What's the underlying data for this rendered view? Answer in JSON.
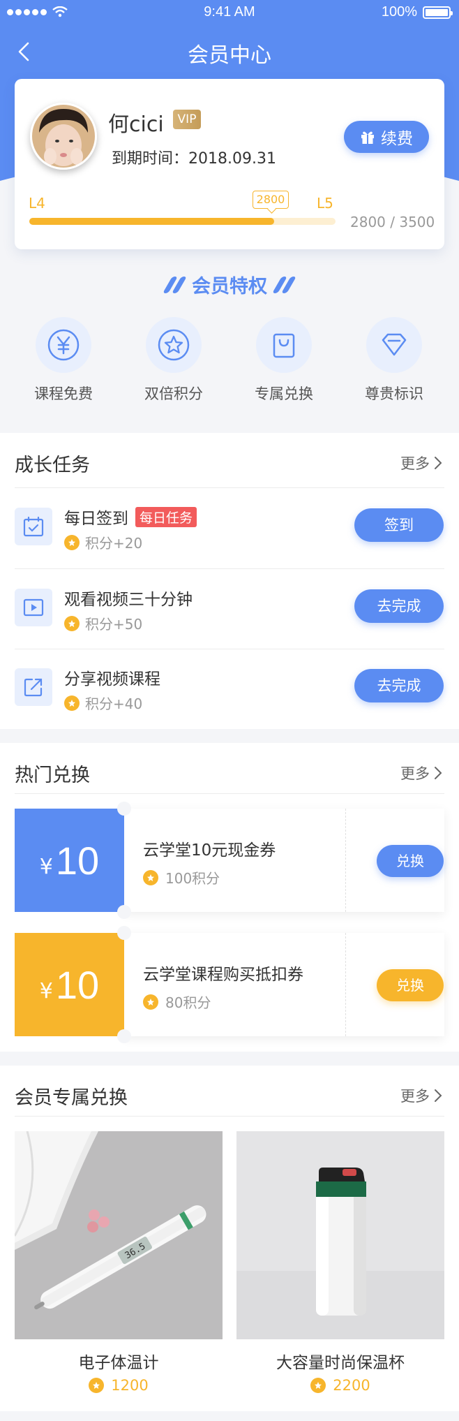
{
  "status_bar": {
    "time": "9:41 AM",
    "battery": "100%"
  },
  "nav": {
    "title": "会员中心"
  },
  "member": {
    "name": "何cici",
    "vip_label": "VIP",
    "expire_label": "到期时间：",
    "expire_date": "2018.09.31",
    "renew_label": "续费",
    "level_current": "L4",
    "level_next": "L5",
    "points_tip": "2800",
    "progress_fraction": 0.8,
    "progress_text": "2800 / 3500"
  },
  "privileges": {
    "title": "会员特权",
    "items": [
      {
        "label": "课程免费",
        "icon": "yen-icon"
      },
      {
        "label": "双倍积分",
        "icon": "star-icon"
      },
      {
        "label": "专属兑换",
        "icon": "bag-icon"
      },
      {
        "label": "尊贵标识",
        "icon": "diamond-icon"
      }
    ]
  },
  "tasks": {
    "title": "成长任务",
    "more": "更多",
    "items": [
      {
        "name": "每日签到",
        "tag": "每日任务",
        "points": "积分+20",
        "button": "签到",
        "icon": "calendar-icon"
      },
      {
        "name": "观看视频三十分钟",
        "tag": "",
        "points": "积分+50",
        "button": "去完成",
        "icon": "video-play-icon"
      },
      {
        "name": "分享视频课程",
        "tag": "",
        "points": "积分+40",
        "button": "去完成",
        "icon": "share-icon"
      }
    ]
  },
  "exchange": {
    "title": "热门兑换",
    "more": "更多",
    "coupons": [
      {
        "currency": "¥",
        "amount": "10",
        "name": "云学堂10元现金券",
        "points": "100积分",
        "button": "兑换",
        "color": "#5b8cf2"
      },
      {
        "currency": "¥",
        "amount": "10",
        "name": "云学堂课程购买抵扣券",
        "points": "80积分",
        "button": "兑换",
        "color": "#f7b52c"
      }
    ]
  },
  "exclusive": {
    "title": "会员专属兑换",
    "more": "更多",
    "products": [
      {
        "name": "电子体温计",
        "points": "1200",
        "thermo_display": "36.5"
      },
      {
        "name": "大容量时尚保温杯",
        "points": "2200"
      }
    ]
  },
  "colors": {
    "primary": "#5b8cf2",
    "accent": "#f7b52c",
    "tag_red": "#f25b5b",
    "vip_gold": "#c49c58"
  }
}
